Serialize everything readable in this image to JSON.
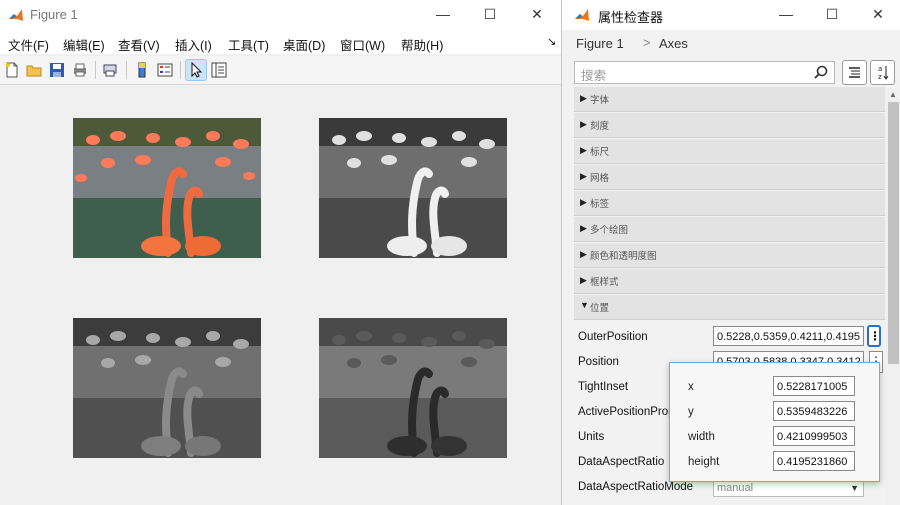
{
  "figure": {
    "title": "Figure 1",
    "window_buttons": {
      "minimize": "—",
      "maximize": "☐",
      "close": "✕"
    },
    "menu": [
      "文件(F)",
      "编辑(E)",
      "查看(V)",
      "插入(I)",
      "工具(T)",
      "桌面(D)",
      "窗口(W)",
      "帮助(H)"
    ],
    "menu_arrow": "↘",
    "toolbar": [
      "new-figure-icon",
      "open-folder-icon",
      "save-icon",
      "print-icon",
      "print-preview-icon",
      "colorbar-icon",
      "legend-icon",
      "edit-plot-arrow-icon",
      "property-inspector-icon"
    ],
    "images": [
      "flamingos-color",
      "flamingos-gray-light",
      "flamingos-gray-mid",
      "flamingos-gray-dark"
    ]
  },
  "inspector": {
    "title": "属性检查器",
    "window_buttons": {
      "minimize": "—",
      "maximize": "☐",
      "close": "✕"
    },
    "breadcrumb": [
      "Figure 1",
      "Axes"
    ],
    "breadcrumb_sep": ">",
    "search_placeholder": "搜索",
    "sections": [
      "字体",
      "刻度",
      "标尺",
      "网格",
      "标签",
      "多个绘图",
      "颜色和透明度图",
      "框样式"
    ],
    "expanded_section": "位置",
    "properties": [
      {
        "name": "OuterPosition",
        "value": "0.5228,0.5359,0.4211,0.4195"
      },
      {
        "name": "Position",
        "value": "0.5703,0.5838,0.3347,0.3412"
      },
      {
        "name": "TightInset",
        "value": ""
      },
      {
        "name": "ActivePositionProperty",
        "value": ""
      },
      {
        "name": "Units",
        "value": ""
      },
      {
        "name": "DataAspectRatio",
        "value": ""
      },
      {
        "name": "DataAspectRatioMode",
        "value": "manual"
      }
    ],
    "popup": [
      {
        "label": "x",
        "value": "0.5228171005"
      },
      {
        "label": "y",
        "value": "0.5359483226"
      },
      {
        "label": "width",
        "value": "0.4210999503"
      },
      {
        "label": "height",
        "value": "0.4195231860"
      }
    ]
  }
}
